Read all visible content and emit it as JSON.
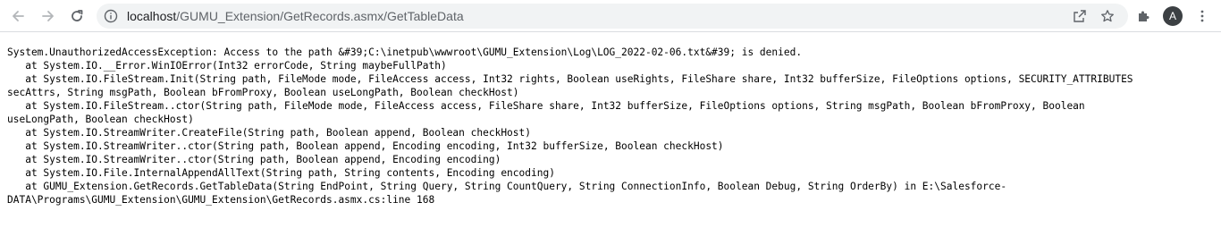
{
  "toolbar": {
    "icons": {
      "back": "arrow-left-icon",
      "forward": "arrow-right-icon",
      "reload": "reload-icon",
      "site_info": "info-icon",
      "share": "share-icon",
      "bookmark": "star-icon",
      "extensions": "puzzle-icon"
    },
    "url_host": "localhost",
    "url_path": "/GUMU_Extension/GetRecords.asmx/GetTableData",
    "profile_initial": "A"
  },
  "content": {
    "lines": [
      "System.UnauthorizedAccessException: Access to the path &#39;C:\\inetpub\\wwwroot\\GUMU_Extension\\Log\\LOG_2022-02-06.txt&#39; is denied.",
      "   at System.IO.__Error.WinIOError(Int32 errorCode, String maybeFullPath)",
      "   at System.IO.FileStream.Init(String path, FileMode mode, FileAccess access, Int32 rights, Boolean useRights, FileShare share, Int32 bufferSize, FileOptions options, SECURITY_ATTRIBUTES",
      "secAttrs, String msgPath, Boolean bFromProxy, Boolean useLongPath, Boolean checkHost)",
      "   at System.IO.FileStream..ctor(String path, FileMode mode, FileAccess access, FileShare share, Int32 bufferSize, FileOptions options, String msgPath, Boolean bFromProxy, Boolean",
      "useLongPath, Boolean checkHost)",
      "   at System.IO.StreamWriter.CreateFile(String path, Boolean append, Boolean checkHost)",
      "   at System.IO.StreamWriter..ctor(String path, Boolean append, Encoding encoding, Int32 bufferSize, Boolean checkHost)",
      "   at System.IO.StreamWriter..ctor(String path, Boolean append, Encoding encoding)",
      "   at System.IO.File.InternalAppendAllText(String path, String contents, Encoding encoding)",
      "   at GUMU_Extension.GetRecords.GetTableData(String EndPoint, String Query, String CountQuery, String ConnectionInfo, Boolean Debug, String OrderBy) in E:\\Salesforce-",
      "DATA\\Programs\\GUMU_Extension\\GUMU_Extension\\GetRecords.asmx.cs:line 168"
    ]
  }
}
